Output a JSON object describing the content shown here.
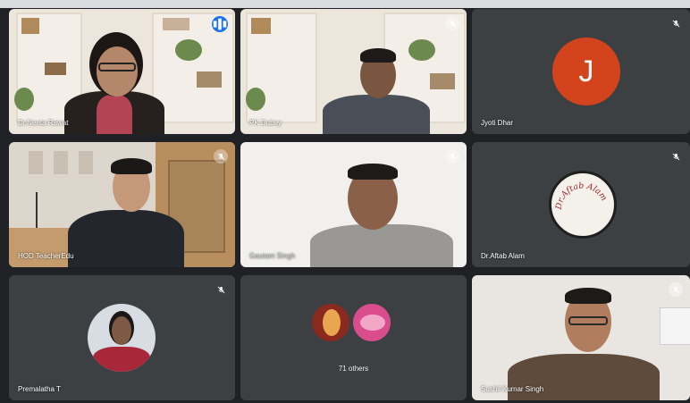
{
  "participants": [
    {
      "name": "Dr.Neeta Rawat",
      "status": "speaking"
    },
    {
      "name": "PK Dubey",
      "status": "muted"
    },
    {
      "name": "Jyoti Dhar",
      "initial": "J",
      "status": "muted"
    },
    {
      "name": "HOD TeacherEdu",
      "status": "muted"
    },
    {
      "name": "Gautam Singh",
      "status": "muted"
    },
    {
      "name": "Dr.Aftab Alam",
      "logo_text": "Dr.Aftab Alam",
      "status": "muted"
    },
    {
      "name": "Premalatha T",
      "status": "muted"
    },
    {
      "name": "Sushil Kumar Singh",
      "status": "muted"
    }
  ],
  "others": {
    "label": "71 others"
  },
  "colors": {
    "background": "#202124",
    "tile": "#3c4043",
    "avatar_j": "#d4441c",
    "speaking": "#1a73e8"
  }
}
